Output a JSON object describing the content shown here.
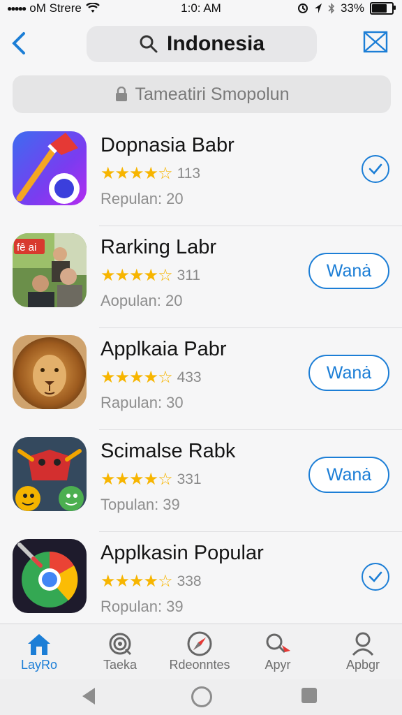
{
  "status": {
    "carrier": "oM Strere",
    "time": "1:0: AM",
    "battery": "33%"
  },
  "header": {
    "search_text": "Indonesia"
  },
  "promo": {
    "label": "Tameatiri Smopolun"
  },
  "apps": [
    {
      "title": "Dopnasia Babr",
      "rating_count": "113",
      "popular": "Repulan: 20",
      "action": "check",
      "action_label": ""
    },
    {
      "title": "Rarking Labr",
      "rating_count": "311",
      "popular": "Aopulan: 20",
      "action": "button",
      "action_label": "Wanȧ",
      "icon_overlay_text": "fê ai"
    },
    {
      "title": "Applkaia Pabr",
      "rating_count": "433",
      "popular": "Rapulan: 30",
      "action": "button",
      "action_label": "Wanȧ"
    },
    {
      "title": "Scimalse Rabk",
      "rating_count": "331",
      "popular": "Topulan: 39",
      "action": "button",
      "action_label": "Wanȧ"
    },
    {
      "title": "Applkasin Popular",
      "rating_count": "338",
      "popular": "Ropulan: 39",
      "action": "check",
      "action_label": ""
    }
  ],
  "tabs": [
    {
      "label": "LayRo",
      "icon": "home-icon",
      "active": true
    },
    {
      "label": "Taeka",
      "icon": "target-icon",
      "active": false
    },
    {
      "label": "Rdeonntes",
      "icon": "compass-icon",
      "active": false
    },
    {
      "label": "Apyr",
      "icon": "search-icon",
      "active": false
    },
    {
      "label": "Apbgr",
      "icon": "person-icon",
      "active": false
    }
  ],
  "colors": {
    "accent": "#1c7ed6",
    "star": "#f7b500"
  }
}
